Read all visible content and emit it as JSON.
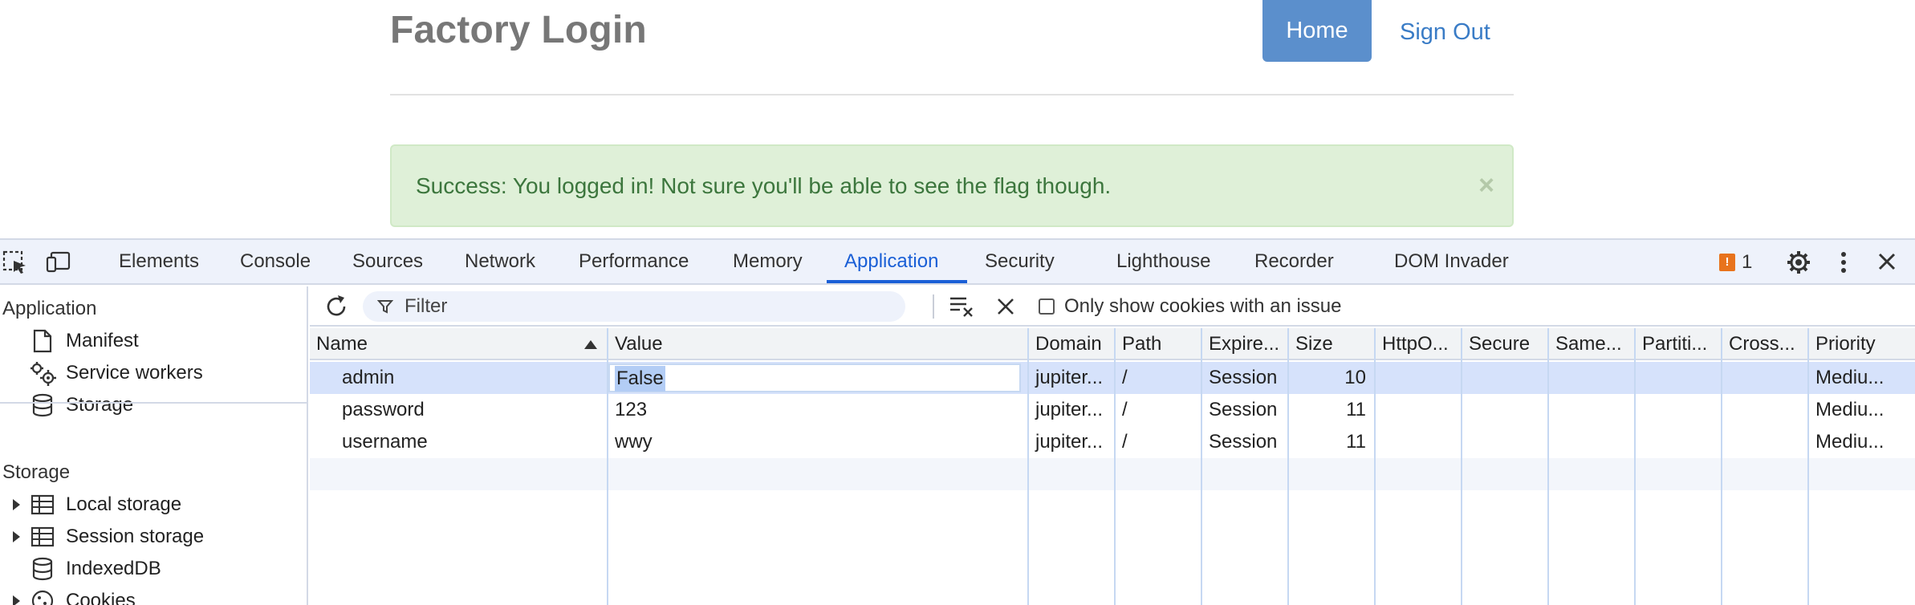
{
  "page": {
    "title": "Factory Login",
    "nav": {
      "home": "Home",
      "sign_out": "Sign Out"
    },
    "alert": {
      "message": "Success: You logged in! Not sure you'll be able to see the flag though.",
      "close": "×"
    }
  },
  "devtools": {
    "tabs": [
      "Elements",
      "Console",
      "Sources",
      "Network",
      "Performance",
      "Memory",
      "Application",
      "Security",
      "Lighthouse",
      "Recorder",
      "DOM Invader"
    ],
    "active_tab": "Application",
    "issues_count": "1",
    "accent_color": "#1a5fd6",
    "sidebar": {
      "application_heading": "Application",
      "application_items": [
        {
          "label": "Manifest",
          "icon": "file-icon"
        },
        {
          "label": "Service workers",
          "icon": "gears-icon"
        },
        {
          "label": "Storage",
          "icon": "database-icon"
        }
      ],
      "storage_heading": "Storage",
      "storage_items": [
        {
          "label": "Local storage",
          "icon": "table-icon",
          "expandable": true
        },
        {
          "label": "Session storage",
          "icon": "table-icon",
          "expandable": true
        },
        {
          "label": "IndexedDB",
          "icon": "database-icon",
          "expandable": false
        },
        {
          "label": "Cookies",
          "icon": "cookie-icon",
          "expandable": true
        }
      ]
    },
    "cookies_toolbar": {
      "filter_placeholder": "Filter",
      "only_issues_label": "Only show cookies with an issue",
      "only_issues_checked": false
    },
    "cookies_table": {
      "columns": [
        "Name",
        "Value",
        "Domain",
        "Path",
        "Expire...",
        "Size",
        "HttpO...",
        "Secure",
        "Same...",
        "Partiti...",
        "Cross...",
        "Priority"
      ],
      "sorted_column": "Name",
      "rows": [
        {
          "name": "admin",
          "value": "False",
          "domain": "jupiter...",
          "path": "/",
          "expires": "Session",
          "size": "10",
          "httponly": "",
          "secure": "",
          "samesite": "",
          "partition": "",
          "cross": "",
          "priority": "Mediu...",
          "selected": true,
          "editing": true
        },
        {
          "name": "password",
          "value": "123",
          "domain": "jupiter...",
          "path": "/",
          "expires": "Session",
          "size": "11",
          "httponly": "",
          "secure": "",
          "samesite": "",
          "partition": "",
          "cross": "",
          "priority": "Mediu...",
          "selected": false
        },
        {
          "name": "username",
          "value": "wwy",
          "domain": "jupiter...",
          "path": "/",
          "expires": "Session",
          "size": "11",
          "httponly": "",
          "secure": "",
          "samesite": "",
          "partition": "",
          "cross": "",
          "priority": "Mediu...",
          "selected": false
        }
      ]
    }
  }
}
